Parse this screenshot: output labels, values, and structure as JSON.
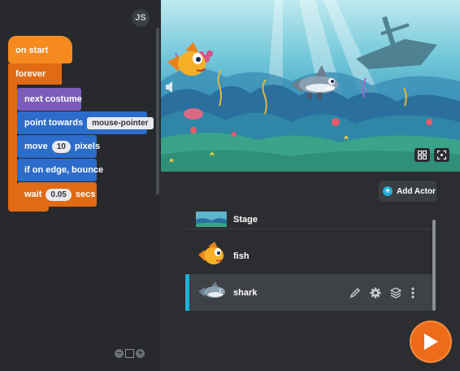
{
  "editor": {
    "lang_button": "JS",
    "blocks": {
      "on_start": "on start",
      "forever": "forever",
      "next_costume": "next costume",
      "point_towards": "point towards",
      "point_target": "mouse-pointer",
      "move": "move",
      "move_value": "10",
      "move_unit": "pixels",
      "if_on_edge": "if on edge, bounce",
      "wait": "wait",
      "wait_value": "0.05",
      "wait_unit": "secs"
    },
    "zoom_controls": {
      "minus": "−",
      "plus": "+"
    }
  },
  "stage": {
    "icons": [
      "expand-icon",
      "grid-icon"
    ]
  },
  "actors": {
    "add_label": "Add Actor",
    "items": [
      {
        "name": "Stage"
      },
      {
        "name": "fish"
      },
      {
        "name": "shark",
        "selected": true
      }
    ]
  },
  "colors": {
    "accent": "#1fb0d8",
    "play": "#ee6b1a",
    "event": "#f58a1f",
    "control": "#e06b14",
    "looks": "#7b5cba",
    "motion": "#2c6ccb"
  }
}
